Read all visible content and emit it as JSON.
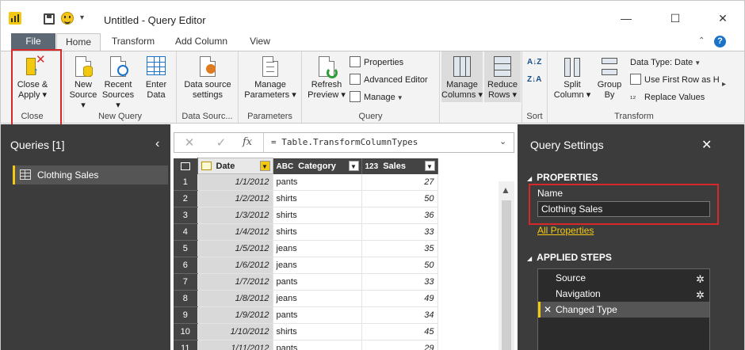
{
  "window": {
    "title": "Untitled - Query Editor",
    "qat_menu": "▾",
    "minimize": "—",
    "maximize": "☐",
    "close": "✕"
  },
  "tabs": [
    {
      "label": "File"
    },
    {
      "label": "Home"
    },
    {
      "label": "Transform"
    },
    {
      "label": "Add Column"
    },
    {
      "label": "View"
    }
  ],
  "ribbon": {
    "collapse": "⌃",
    "help": "?",
    "scroll_right": "▸",
    "groups": {
      "close": "Close",
      "new_query": "New Query",
      "data_sources": "Data Sourc...",
      "parameters": "Parameters",
      "query": "Query",
      "sort": "Sort",
      "transform": "Transform"
    },
    "buttons": {
      "close_apply": [
        "Close &",
        "Apply ▾"
      ],
      "new_source": [
        "New",
        "Source ▾"
      ],
      "recent_sources": [
        "Recent",
        "Sources ▾"
      ],
      "enter_data": [
        "Enter",
        "Data"
      ],
      "data_source_settings": [
        "Data source",
        "settings"
      ],
      "manage_parameters": [
        "Manage",
        "Parameters ▾"
      ],
      "refresh_preview": [
        "Refresh",
        "Preview ▾"
      ],
      "properties": "Properties",
      "advanced_editor": "Advanced Editor",
      "manage": "Manage",
      "manage_columns": [
        "Manage",
        "Columns ▾"
      ],
      "reduce_rows": [
        "Reduce",
        "Rows ▾"
      ],
      "sort_asc": "A↓Z",
      "sort_desc": "Z↓A",
      "split_column": [
        "Split",
        "Column ▾"
      ],
      "group_by": [
        "Group",
        "By"
      ],
      "data_type": "Data Type: Date",
      "use_first_row": "Use First Row as H",
      "replace_values": "Replace Values"
    }
  },
  "queries_pane": {
    "title": "Queries [1]",
    "collapse": "‹",
    "items": [
      {
        "label": "Clothing Sales"
      }
    ]
  },
  "formula_bar": {
    "cancel": "✕",
    "confirm": "✓",
    "fx": "fx",
    "formula": "= Table.TransformColumnTypes",
    "expand": "⌄"
  },
  "table": {
    "columns": [
      {
        "type": "",
        "name": "Date"
      },
      {
        "type": "ABC",
        "name": "Category"
      },
      {
        "type": "123",
        "name": "Sales"
      }
    ],
    "rows": [
      {
        "n": "1",
        "date": "1/1/2012",
        "category": "pants",
        "sales": "27"
      },
      {
        "n": "2",
        "date": "1/2/2012",
        "category": "shirts",
        "sales": "50"
      },
      {
        "n": "3",
        "date": "1/3/2012",
        "category": "shirts",
        "sales": "36"
      },
      {
        "n": "4",
        "date": "1/4/2012",
        "category": "shirts",
        "sales": "33"
      },
      {
        "n": "5",
        "date": "1/5/2012",
        "category": "jeans",
        "sales": "35"
      },
      {
        "n": "6",
        "date": "1/6/2012",
        "category": "jeans",
        "sales": "50"
      },
      {
        "n": "7",
        "date": "1/7/2012",
        "category": "pants",
        "sales": "33"
      },
      {
        "n": "8",
        "date": "1/8/2012",
        "category": "jeans",
        "sales": "49"
      },
      {
        "n": "9",
        "date": "1/9/2012",
        "category": "pants",
        "sales": "34"
      },
      {
        "n": "10",
        "date": "1/10/2012",
        "category": "shirts",
        "sales": "45"
      },
      {
        "n": "11",
        "date": "1/11/2012",
        "category": "pants",
        "sales": "29"
      }
    ]
  },
  "settings": {
    "title": "Query Settings",
    "close": "✕",
    "properties_header": "PROPERTIES",
    "name_label": "Name",
    "name_value": "Clothing Sales",
    "all_properties": "All Properties",
    "applied_steps_header": "APPLIED STEPS",
    "steps": [
      {
        "label": "Source",
        "gear": "✲"
      },
      {
        "label": "Navigation",
        "gear": "✲"
      },
      {
        "label": "Changed Type"
      }
    ],
    "active_step_mark": "✕"
  },
  "colors": {
    "accent": "#f2c811",
    "highlight": "#d62828",
    "dark_pane": "#3c3c3c",
    "file_tab": "#5d6875"
  }
}
